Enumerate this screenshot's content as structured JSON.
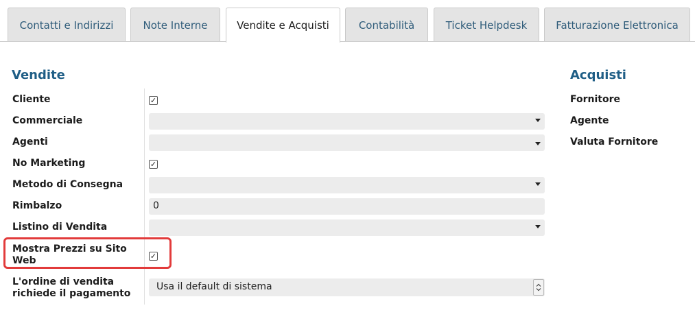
{
  "tabs": [
    {
      "label": "Contatti e Indirizzi",
      "active": false
    },
    {
      "label": "Note Interne",
      "active": false
    },
    {
      "label": "Vendite e Acquisti",
      "active": true
    },
    {
      "label": "Contabilità",
      "active": false
    },
    {
      "label": "Ticket Helpdesk",
      "active": false
    },
    {
      "label": "Fatturazione Elettronica",
      "active": false
    }
  ],
  "sales": {
    "title": "Vendite",
    "cliente": {
      "label": "Cliente",
      "checked": true
    },
    "commerciale": {
      "label": "Commerciale",
      "value": ""
    },
    "agenti": {
      "label": "Agenti",
      "value": ""
    },
    "no_marketing": {
      "label": "No Marketing",
      "checked": true
    },
    "metodo_consegna": {
      "label": "Metodo di Consegna",
      "value": ""
    },
    "rimbalzo": {
      "label": "Rimbalzo",
      "value": "0"
    },
    "listino": {
      "label": "Listino di Vendita",
      "value": ""
    },
    "mostra_prezzi": {
      "label_line1": "Mostra Prezzi su Sito",
      "label_line2": "Web",
      "checked": true
    },
    "ordine_pagamento": {
      "label_line1": "L'ordine di vendita",
      "label_line2": "richiede il pagamento",
      "value": "Usa il default di sistema"
    }
  },
  "purchases": {
    "title": "Acquisti",
    "fornitore": "Fornitore",
    "agente": "Agente",
    "valuta_fornitore": "Valuta Fornitore"
  },
  "check_glyph": "✓",
  "colors": {
    "accent": "#1f5e86",
    "highlight": "#e23b3b",
    "tab_text": "#2f5c7a"
  }
}
